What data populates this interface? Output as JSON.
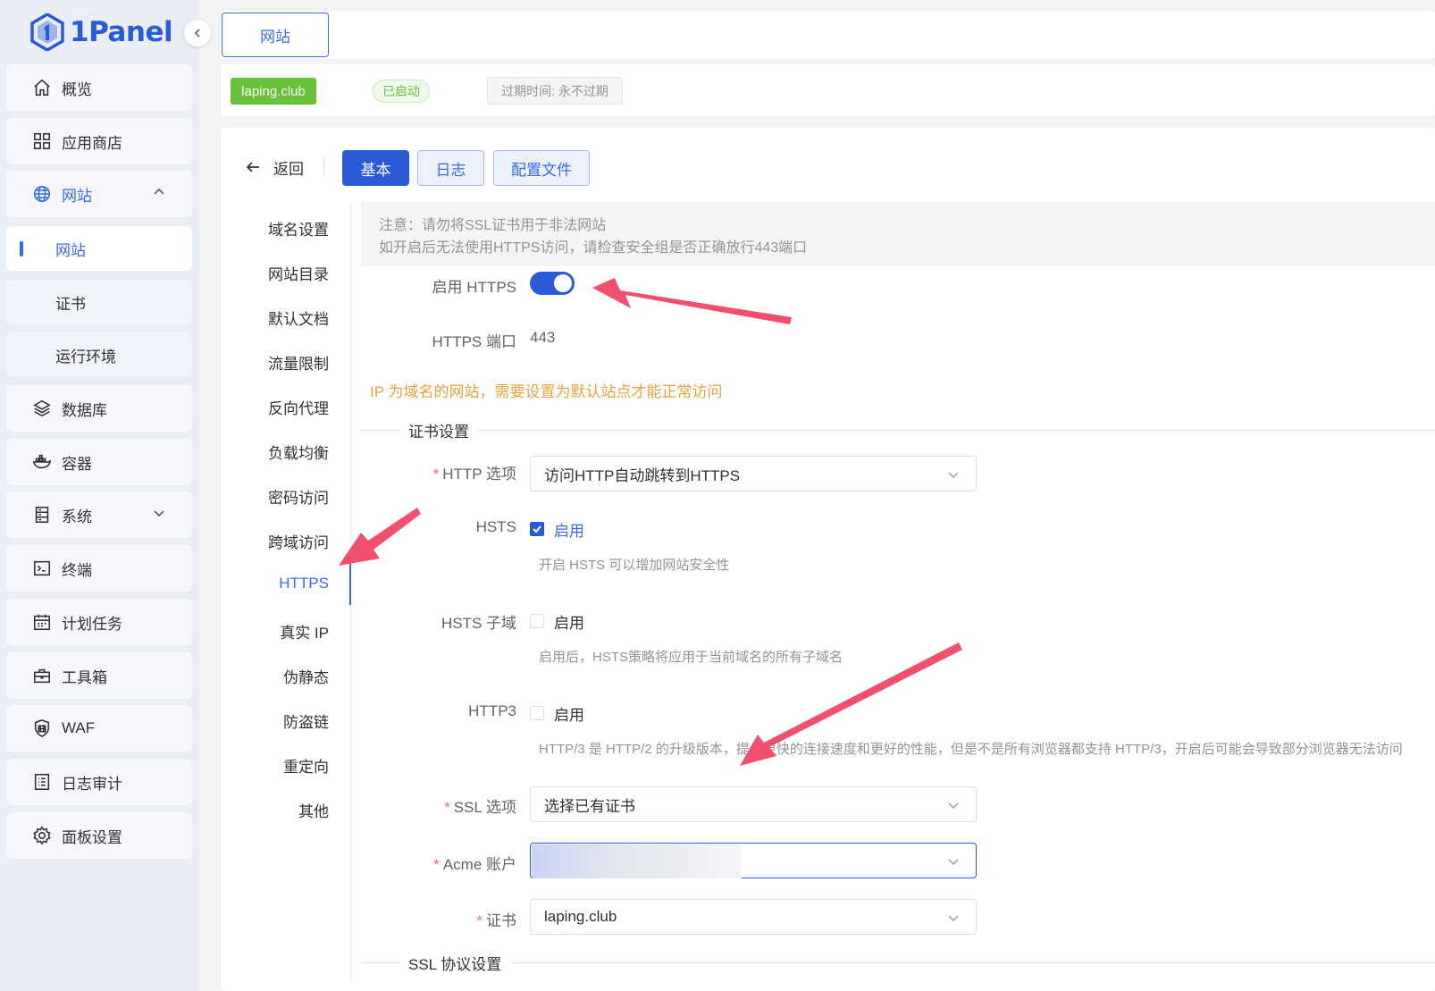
{
  "app": {
    "logo_text": "1Panel"
  },
  "sidebar": {
    "items": [
      {
        "label": "概览",
        "icon": "home-icon"
      },
      {
        "label": "应用商店",
        "icon": "apps-grid-icon"
      },
      {
        "label": "网站",
        "icon": "globe-icon",
        "expanded": true
      },
      {
        "label": "数据库",
        "icon": "layers-icon"
      },
      {
        "label": "容器",
        "icon": "docker-icon"
      },
      {
        "label": "系统",
        "icon": "server-icon"
      },
      {
        "label": "终端",
        "icon": "terminal-icon"
      },
      {
        "label": "计划任务",
        "icon": "calendar-icon"
      },
      {
        "label": "工具箱",
        "icon": "toolbox-icon"
      },
      {
        "label": "WAF",
        "icon": "shield-icon"
      },
      {
        "label": "日志审计",
        "icon": "log-list-icon"
      },
      {
        "label": "面板设置",
        "icon": "gear-icon"
      }
    ],
    "sub_items": [
      {
        "label": "网站",
        "active": true
      },
      {
        "label": "证书"
      },
      {
        "label": "运行环境"
      }
    ]
  },
  "top_tab": {
    "label": "网站"
  },
  "site_info": {
    "domain": "laping.club",
    "status": "已启动",
    "expire": "过期时间: 永不过期"
  },
  "toolbar": {
    "back_label": "返回",
    "tabs": [
      "基本",
      "日志",
      "配置文件"
    ],
    "active_tab": "基本"
  },
  "side_nav": [
    "域名设置",
    "网站目录",
    "默认文档",
    "流量限制",
    "反向代理",
    "负载均衡",
    "密码访问",
    "跨域访问",
    "HTTPS",
    "真实 IP",
    "伪静态",
    "防盗链",
    "重定向",
    "其他"
  ],
  "side_nav_active": "HTTPS",
  "notice": {
    "line1": "注意：请勿将SSL证书用于非法网站",
    "line2": "如开启后无法使用HTTPS访问，请检查安全组是否正确放行443端口"
  },
  "form": {
    "enable_https_label": "启用 HTTPS",
    "enable_https": true,
    "https_port_label": "HTTPS 端口",
    "https_port": "443",
    "ip_warning": "IP 为域名的网站，需要设置为默认站点才能正常访问",
    "cert_section": "证书设置",
    "http_option_label": "HTTP 选项",
    "http_option_value": "访问HTTP自动跳转到HTTPS",
    "hsts_label": "HSTS",
    "hsts_checked": true,
    "hsts_check_text": "启用",
    "hsts_help": "开启 HSTS 可以增加网站安全性",
    "hsts_sub_label": "HSTS 子域",
    "hsts_sub_checked": false,
    "hsts_sub_check_text": "启用",
    "hsts_sub_help": "启用后，HSTS策略将应用于当前域名的所有子域名",
    "http3_label": "HTTP3",
    "http3_checked": false,
    "http3_check_text": "启用",
    "http3_help": "HTTP/3 是 HTTP/2 的升级版本，提供更快的连接速度和更好的性能，但是不是所有浏览器都支持 HTTP/3，开启后可能会导致部分浏览器无法访问",
    "ssl_option_label": "SSL 选项",
    "ssl_option_value": "选择已有证书",
    "acme_label": "Acme 账户",
    "acme_value": "",
    "cert_label": "证书",
    "cert_value": "laping.club",
    "ssl_protocol_section": "SSL 协议设置"
  },
  "colors": {
    "primary": "#2a5ad7",
    "success": "#67c23a",
    "warning": "#e6a23c",
    "annotation_arrow": "#f0506e"
  }
}
